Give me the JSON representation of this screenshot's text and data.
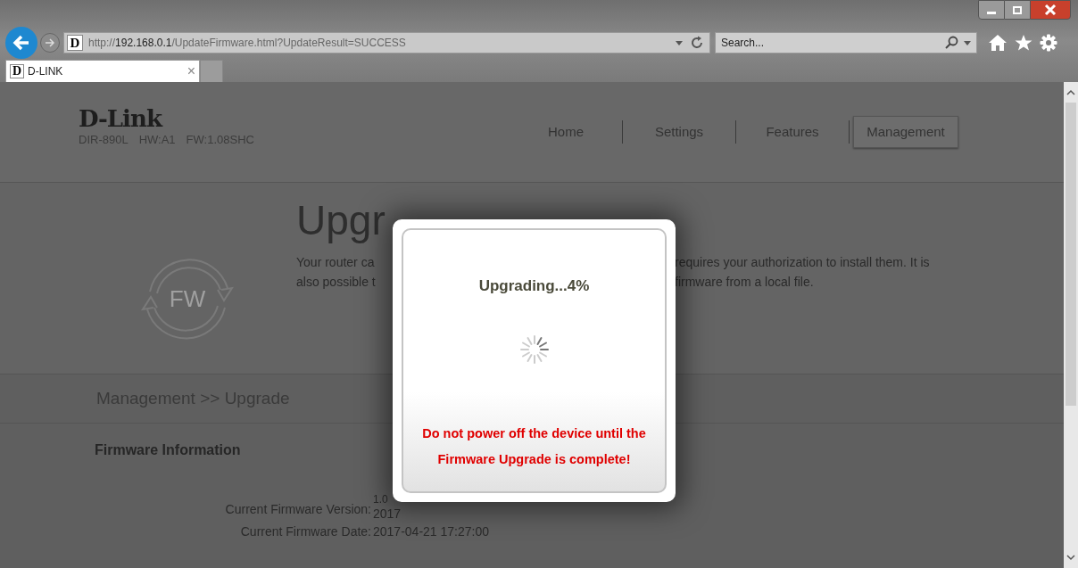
{
  "browser": {
    "favicon_letter_address": "D",
    "url_scheme": "http://",
    "url_host": "192.168.0.1",
    "url_path": "/UpdateFirmware.html?UpdateResult=SUCCESS",
    "search": {
      "placeholder": "Search..."
    },
    "tabs": [
      {
        "favicon_letter": "D",
        "label": "D-LINK",
        "close": "×",
        "selected": true
      }
    ]
  },
  "header": {
    "logo": "D-Link",
    "device_info": [
      "DIR-890L",
      "HW:A1",
      "FW:1.08SHC"
    ],
    "nav": [
      {
        "label": "Home",
        "selected": false
      },
      {
        "label": "Settings",
        "selected": false
      },
      {
        "label": "Features",
        "selected": false
      },
      {
        "label": "Management",
        "selected": true
      }
    ]
  },
  "intro": {
    "icon_label": "FW",
    "heading": "Upgr",
    "description_left": [
      "Your router ca",
      "also possible t"
    ],
    "description_right": [
      "requires your authorization to install them. It is",
      "firmware from a local file."
    ]
  },
  "breadcrumb": "Management >> Upgrade",
  "firmware_info": {
    "title": "Firmware Information",
    "rows": [
      {
        "label": "Current Firmware Version:",
        "value_lines": [
          "1.0",
          "2017"
        ]
      },
      {
        "label": "Current Firmware Date:",
        "value_lines": [
          "2017-04-21 17:27:00"
        ]
      }
    ]
  },
  "dialog": {
    "status": "Upgrading...4%",
    "warning_lines": [
      "Do not power off the device until the",
      "Firmware Upgrade is complete!"
    ]
  }
}
